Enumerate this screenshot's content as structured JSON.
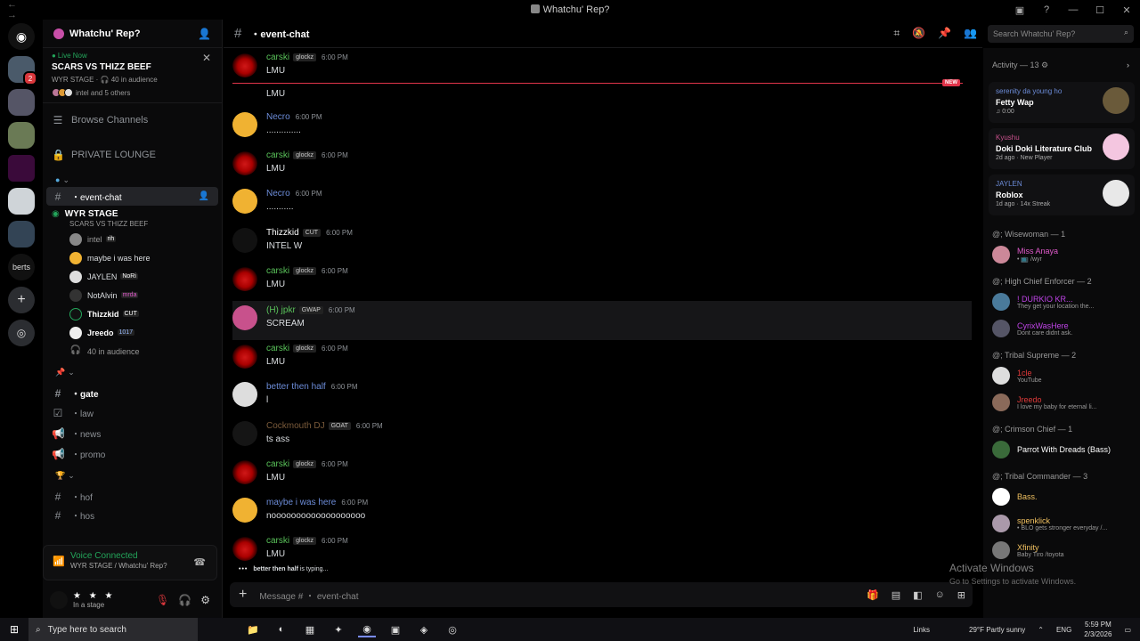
{
  "window": {
    "title": "Whatchu' Rep?"
  },
  "rail": {
    "servers": [
      "discord-home",
      "server-1",
      "server-2",
      "server-3",
      "server-4",
      "server-5",
      "server-6",
      "server-7",
      "berts",
      "add-server",
      "discover"
    ],
    "berts_label": "berts"
  },
  "server": {
    "name": "Whatchu' Rep?"
  },
  "live": {
    "label": "Live Now",
    "title": "SCARS VS THIZZ BEEF",
    "sub": "WYR STAGE · 🎧 40 in audience",
    "others": "intel and 5 others"
  },
  "nav": {
    "browse": "Browse Channels",
    "private": "PRIVATE LOUNGE",
    "event_chat": "・event-chat"
  },
  "stage": {
    "name": "WYR STAGE",
    "sub": "SCARS VS THIZZ BEEF",
    "members": [
      {
        "name": "intel",
        "tag": "rih"
      },
      {
        "name": "maybe i was here",
        "tag": ""
      },
      {
        "name": "JAYLEN",
        "tag": "NoRi"
      },
      {
        "name": "NotAlvin",
        "tag": "mrda"
      },
      {
        "name": "Thizzkid",
        "tag": "CUT"
      },
      {
        "name": "Jreedo",
        "tag": "1017"
      }
    ],
    "audience": "40 in audience"
  },
  "channels": [
    {
      "name": "・gate",
      "bold": true
    },
    {
      "name": "・law"
    },
    {
      "name": "・news"
    },
    {
      "name": "・promo"
    },
    {
      "name": "・hof"
    },
    {
      "name": "・hos"
    }
  ],
  "voice": {
    "status": "Voice Connected",
    "where": "WYR STAGE / Whatchu' Rep?"
  },
  "user": {
    "stars": "★ ★ ★",
    "status": "In a stage"
  },
  "chat": {
    "channel": "・event-chat",
    "search_placeholder": "Search Whatchu' Rep?",
    "new_label": "NEW",
    "first_cont": "LMU",
    "messages": [
      {
        "author": "carski",
        "tag": "glockz",
        "time": "6:00 PM",
        "text": "LMU",
        "color": "#5ac35a"
      },
      {
        "author": "Necro",
        "tag": "",
        "time": "6:00 PM",
        "text": "..............",
        "color": "#6c8cd8"
      },
      {
        "author": "carski",
        "tag": "glockz",
        "time": "6:00 PM",
        "text": "LMU",
        "color": "#5ac35a"
      },
      {
        "author": "Necro",
        "tag": "",
        "time": "6:00 PM",
        "text": "...........",
        "color": "#6c8cd8"
      },
      {
        "author": "Thizzkid",
        "tag": "CUT",
        "time": "6:00 PM",
        "text": "INTEL W",
        "color": "#ffffff"
      },
      {
        "author": "carski",
        "tag": "glockz",
        "time": "6:00 PM",
        "text": "LMU",
        "color": "#5ac35a"
      },
      {
        "author": "(H) jpkr",
        "tag": "GWAP",
        "time": "6:00 PM",
        "text": "SCREAM",
        "color": "#5ac35a"
      },
      {
        "author": "carski",
        "tag": "glockz",
        "time": "6:00 PM",
        "text": "LMU",
        "color": "#5ac35a"
      },
      {
        "author": "better then half",
        "tag": "",
        "time": "6:00 PM",
        "text": "l",
        "color": "#6c8cd8"
      },
      {
        "author": "Cockmouth DJ",
        "tag": "GOAT",
        "time": "6:00 PM",
        "text": "ts ass",
        "color": "#7a5a3a"
      },
      {
        "author": "carski",
        "tag": "glockz",
        "time": "6:00 PM",
        "text": "LMU",
        "color": "#5ac35a"
      },
      {
        "author": "maybe i was here",
        "tag": "",
        "time": "6:00 PM",
        "text": "nooooooooooooooooooo",
        "color": "#6c8cd8"
      },
      {
        "author": "carski",
        "tag": "glockz",
        "time": "6:00 PM",
        "text": "LMU",
        "color": "#5ac35a"
      }
    ],
    "typing_user": "better then half",
    "typing_suffix": " is typing...",
    "composer_placeholder": "Message # ・ event-chat"
  },
  "activity": {
    "header": "Activity — 13",
    "cards": [
      {
        "user": "serenity da young ho",
        "title": "Fetty Wap",
        "sub": "♫ 0:00",
        "ucolor": "#6c8cd8"
      },
      {
        "user": "Kyushu",
        "title": "Doki Doki Literature Club",
        "sub": "2d ago · New Player",
        "ucolor": "#c8518c"
      },
      {
        "user": "JAYLEN",
        "title": "Roblox",
        "sub": "1d ago · 14x Streak",
        "ucolor": "#6c8cd8"
      }
    ]
  },
  "roles": [
    {
      "name": "@; Wisewoman — 1",
      "members": [
        {
          "name": "Miss Anaya",
          "status": "• 📺 /wyr",
          "color": "#e05acb"
        }
      ]
    },
    {
      "name": "@; High Chief Enforcer — 2",
      "members": [
        {
          "name": "! DURKIO KR...",
          "status": "They get your location the...",
          "color": "#c044e8"
        },
        {
          "name": "CyrixWasHere",
          "status": "Dont care didnt ask.",
          "color": "#c044e8"
        }
      ]
    },
    {
      "name": "@; Tribal Supreme — 2",
      "members": [
        {
          "name": "1cle",
          "status": "YouTube",
          "color": "#e03a3a"
        },
        {
          "name": "Jreedo",
          "status": "I love my baby for eternal li...",
          "color": "#e03a3a"
        }
      ]
    },
    {
      "name": "@; Crimson Chief — 1",
      "members": [
        {
          "name": "Parrot With Dreads (Bass)",
          "status": "",
          "color": "#ffffff"
        }
      ]
    },
    {
      "name": "@; Tribal Commander — 3",
      "members": [
        {
          "name": "Bass.",
          "status": "",
          "color": "#f0c060"
        },
        {
          "name": "spenklick",
          "status": "• BLO gets stronger everyday /...",
          "color": "#f0c060"
        },
        {
          "name": "Xfinity",
          "status": "Baby Tiro /toyota",
          "color": "#f0c060"
        }
      ]
    }
  ],
  "watermark": {
    "line1": "Activate Windows",
    "line2": "Go to Settings to activate Windows."
  },
  "taskbar": {
    "search": "Type here to search",
    "links": "Links",
    "weather": "29°F  Partly sunny",
    "lang": "ENG",
    "time": "5:59 PM",
    "date": "2/3/2026"
  }
}
